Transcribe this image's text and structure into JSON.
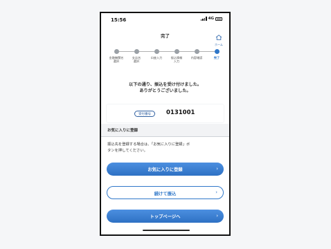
{
  "status_bar": {
    "time": "15:56",
    "network": "4G"
  },
  "header": {
    "title": "完了",
    "home_label": "ホーム"
  },
  "stepper": {
    "steps": [
      {
        "label_line1": "金融機関名",
        "label_line2": "選択"
      },
      {
        "label_line1": "支店名",
        "label_line2": "選択"
      },
      {
        "label_line1": "口座入力",
        "label_line2": ""
      },
      {
        "label_line1": "振込情報",
        "label_line2": "入力"
      },
      {
        "label_line1": "内容確認",
        "label_line2": ""
      },
      {
        "label_line1": "完了",
        "label_line2": ""
      }
    ],
    "active_index": 5
  },
  "message": {
    "line1": "以下の通り、振込を受け付けました。",
    "line2": "ありがとうございました。"
  },
  "receipt": {
    "badge": "受付番号",
    "number": "0131001"
  },
  "favorite": {
    "section_title": "お気に入りに登録",
    "desc_line1": "振込先を登録する場合は、「お気に入りに登録」ボ",
    "desc_line2": "タンを押してください。"
  },
  "buttons": {
    "favorite": "お気に入りに登録",
    "continue": "続けて振込",
    "top": "トップページへ"
  },
  "colors": {
    "accent": "#2f77c9",
    "inactive_dot": "#9aa0a6"
  }
}
